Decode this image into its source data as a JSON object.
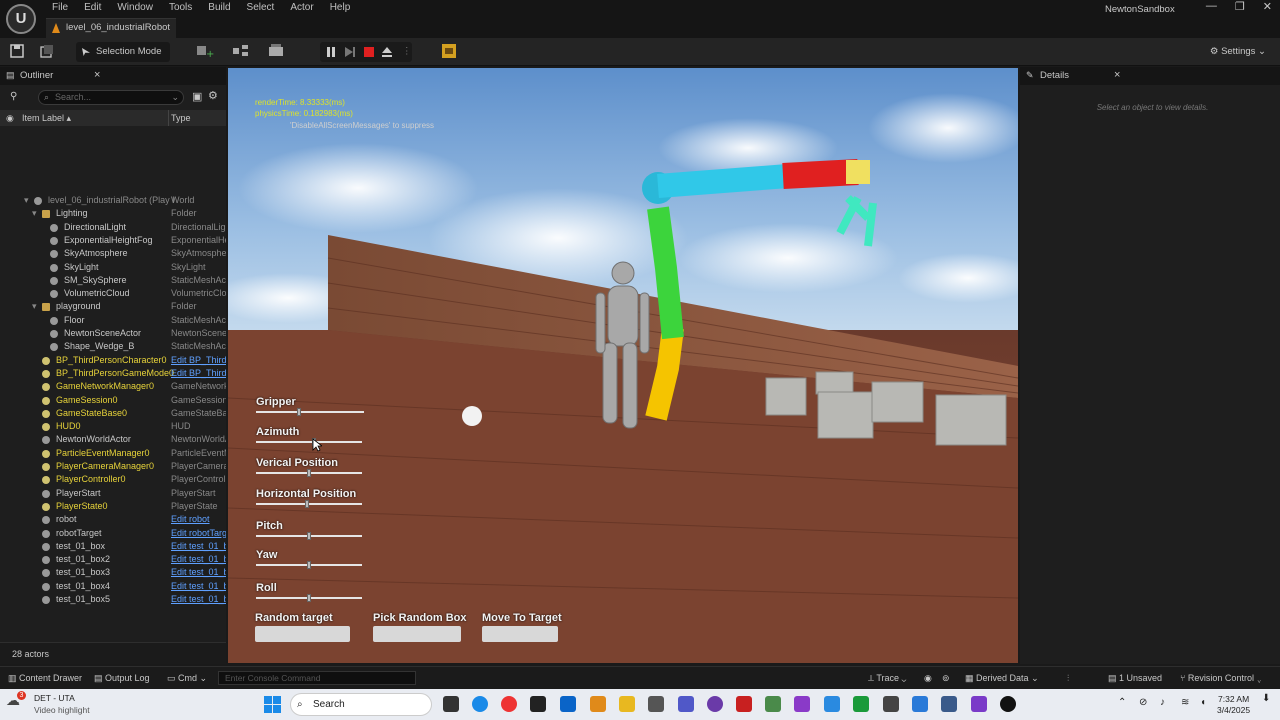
{
  "menubar": {
    "menus": [
      "File",
      "Edit",
      "Window",
      "Tools",
      "Build",
      "Select",
      "Actor",
      "Help"
    ],
    "level_tab": "level_06_industrialRobot",
    "project": "NewtonSandbox",
    "window_controls": [
      "—",
      "❐",
      "✕"
    ]
  },
  "toolbar": {
    "selection_mode": "Selection Mode",
    "settings": "Settings"
  },
  "outliner": {
    "title": "Outliner",
    "search_placeholder": "Search...",
    "col_label": "Item Label",
    "col_type": "Type",
    "rows": [
      {
        "label": "level_06_industrialRobot (Play I",
        "type": "World",
        "indent": 0,
        "icon": "world"
      },
      {
        "label": "Lighting",
        "type": "Folder",
        "indent": 1,
        "icon": "folder"
      },
      {
        "label": "DirectionalLight",
        "type": "DirectionalLigh",
        "indent": 2,
        "icon": "light"
      },
      {
        "label": "ExponentialHeightFog",
        "type": "ExponentialHe",
        "indent": 2,
        "icon": "fog"
      },
      {
        "label": "SkyAtmosphere",
        "type": "SkyAtmosphe",
        "indent": 2,
        "icon": "sky"
      },
      {
        "label": "SkyLight",
        "type": "SkyLight",
        "indent": 2,
        "icon": "light"
      },
      {
        "label": "SM_SkySphere",
        "type": "StaticMeshAc",
        "indent": 2,
        "icon": "mesh"
      },
      {
        "label": "VolumetricCloud",
        "type": "VolumetricClo",
        "indent": 2,
        "icon": "cloud"
      },
      {
        "label": "playground",
        "type": "Folder",
        "indent": 1,
        "icon": "folder"
      },
      {
        "label": "Floor",
        "type": "StaticMeshAc",
        "indent": 2,
        "icon": "mesh"
      },
      {
        "label": "NewtonSceneActor",
        "type": "NewtonScene",
        "indent": 2,
        "icon": "actor"
      },
      {
        "label": "Shape_Wedge_B",
        "type": "StaticMeshAc",
        "indent": 2,
        "icon": "mesh"
      },
      {
        "label": "BP_ThirdPersonCharacter0",
        "type": "Edit BP_ThirdI",
        "indent": 1,
        "icon": "pawn",
        "yellow": true,
        "link": true
      },
      {
        "label": "BP_ThirdPersonGameMode0",
        "type": "Edit BP_Third",
        "indent": 1,
        "icon": "actor",
        "yellow": true,
        "link": true
      },
      {
        "label": "GameNetworkManager0",
        "type": "GameNetwork",
        "indent": 1,
        "icon": "actor",
        "yellow": true
      },
      {
        "label": "GameSession0",
        "type": "GameSession",
        "indent": 1,
        "icon": "actor",
        "yellow": true
      },
      {
        "label": "GameStateBase0",
        "type": "GameStateBa",
        "indent": 1,
        "icon": "actor",
        "yellow": true
      },
      {
        "label": "HUD0",
        "type": "HUD",
        "indent": 1,
        "icon": "hud",
        "yellow": true
      },
      {
        "label": "NewtonWorldActor",
        "type": "NewtonWorldA",
        "indent": 1,
        "icon": "actor"
      },
      {
        "label": "ParticleEventManager0",
        "type": "ParticleEventM",
        "indent": 1,
        "icon": "actor",
        "yellow": true
      },
      {
        "label": "PlayerCameraManager0",
        "type": "PlayerCamera",
        "indent": 1,
        "icon": "camera",
        "yellow": true
      },
      {
        "label": "PlayerController0",
        "type": "PlayerControll",
        "indent": 1,
        "icon": "gamepad",
        "yellow": true
      },
      {
        "label": "PlayerStart",
        "type": "PlayerStart",
        "indent": 1,
        "icon": "actor"
      },
      {
        "label": "PlayerState0",
        "type": "PlayerState",
        "indent": 1,
        "icon": "actor",
        "yellow": true
      },
      {
        "label": "robot",
        "type": "Edit robot",
        "indent": 1,
        "icon": "actor",
        "link": true
      },
      {
        "label": "robotTarget",
        "type": "Edit robotTarg",
        "indent": 1,
        "icon": "actor",
        "link": true
      },
      {
        "label": "test_01_box",
        "type": "Edit test_01_b",
        "indent": 1,
        "icon": "actor",
        "link": true
      },
      {
        "label": "test_01_box2",
        "type": "Edit test_01_b",
        "indent": 1,
        "icon": "actor",
        "link": true
      },
      {
        "label": "test_01_box3",
        "type": "Edit test_01_b",
        "indent": 1,
        "icon": "actor",
        "link": true
      },
      {
        "label": "test_01_box4",
        "type": "Edit test_01_b",
        "indent": 1,
        "icon": "actor",
        "link": true
      },
      {
        "label": "test_01_box5",
        "type": "Edit test_01_b",
        "indent": 1,
        "icon": "actor",
        "link": true
      }
    ],
    "actor_count": "28 actors"
  },
  "viewport": {
    "render_time": "renderTime: 8.33333(ms)",
    "physics_time": "physicsTime: 0.182983(ms)",
    "suppress_hint": "'DisableAllScreenMessages' to suppress",
    "sliders": [
      {
        "label": "Gripper",
        "value": 0.4
      },
      {
        "label": "Azimuth",
        "value": 0.55
      },
      {
        "label": "Verical Position",
        "value": 0.5
      },
      {
        "label": "Horizontal Position",
        "value": 0.48
      },
      {
        "label": "Pitch",
        "value": 0.5
      },
      {
        "label": "Yaw",
        "value": 0.5
      },
      {
        "label": "Roll",
        "value": 0.5
      }
    ],
    "buttons": [
      "Random target",
      "Pick Random Box",
      "Move To Target"
    ]
  },
  "details": {
    "title": "Details",
    "empty_text": "Select an object to view details."
  },
  "statusbar": {
    "content_drawer": "Content Drawer",
    "output_log": "Output Log",
    "cmd": "Cmd",
    "console_placeholder": "Enter Console Command",
    "trace": "Trace",
    "derived_data": "Derived Data",
    "unsaved": "1 Unsaved",
    "revision_control": "Revision Control"
  },
  "taskbar": {
    "weather_title": "DET - UTA",
    "weather_sub": "Video highlight",
    "search": "Search",
    "time": "7:32 AM",
    "date": "3/4/2025"
  }
}
